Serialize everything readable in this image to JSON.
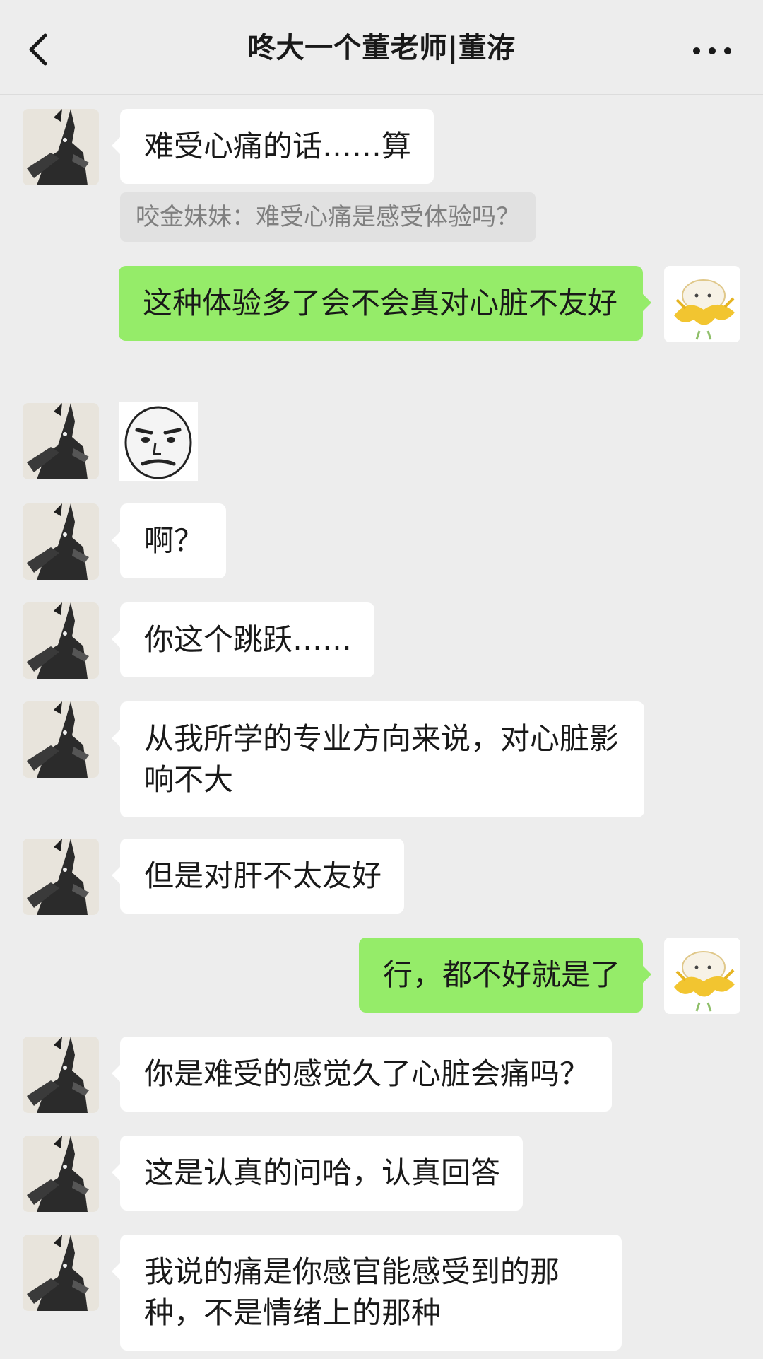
{
  "header": {
    "title": "咚大一个董老师|董洊",
    "back_icon": "chevron-left-icon",
    "more_icon": "more-dots-icon"
  },
  "colors": {
    "background": "#ededed",
    "incoming_bubble": "#ffffff",
    "outgoing_bubble": "#95ec69",
    "quote_background": "#e1e1e1"
  },
  "messages": [
    {
      "side": "incoming",
      "type": "text",
      "text": "难受心痛的话……算"
    },
    {
      "side": "quote",
      "type": "quote",
      "text": "咬金妹妹：难受心痛是感受体验吗？"
    },
    {
      "side": "outgoing",
      "type": "text",
      "text": "这种体验多了会不会真对心脏不友好"
    },
    {
      "side": "incoming",
      "type": "sticker",
      "icon": "frowning-face-sticker"
    },
    {
      "side": "incoming",
      "type": "text",
      "text": "啊？"
    },
    {
      "side": "incoming",
      "type": "text",
      "text": "你这个跳跃……"
    },
    {
      "side": "incoming",
      "type": "text",
      "text": "从我所学的专业方向来说，对心脏影响不大"
    },
    {
      "side": "incoming",
      "type": "text",
      "text": "但是对肝不太友好"
    },
    {
      "side": "outgoing",
      "type": "text",
      "text": "行，都不好就是了"
    },
    {
      "side": "incoming",
      "type": "text",
      "text": "你是难受的感觉久了心脏会痛吗？"
    },
    {
      "side": "incoming",
      "type": "text",
      "text": "这是认真的问哈，认真回答"
    },
    {
      "side": "incoming",
      "type": "text",
      "text": "我说的痛是你感官能感受到的那种，不是情绪上的那种"
    }
  ]
}
